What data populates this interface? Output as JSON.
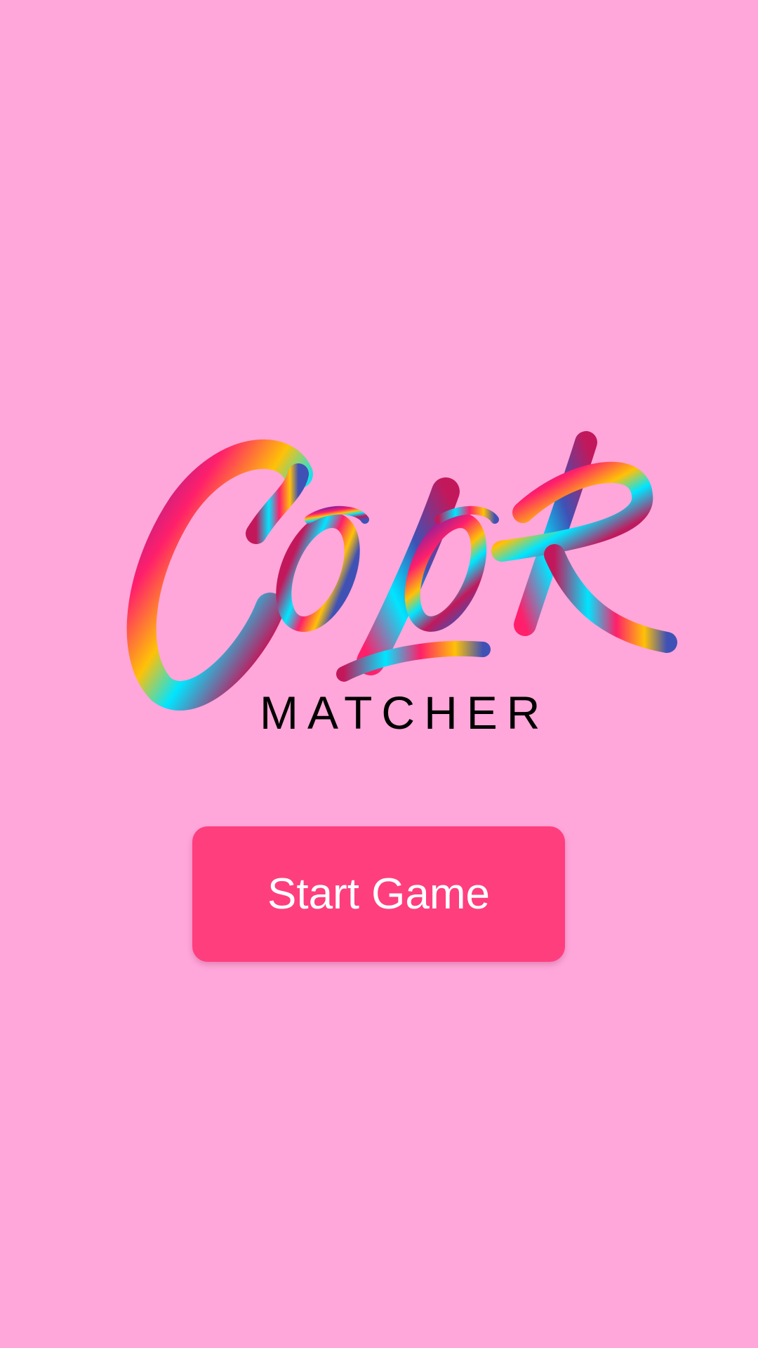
{
  "app": {
    "background_color": "#FFA6DA"
  },
  "logo": {
    "word": "COLOR",
    "subtitle": "MATCHER",
    "stroke_colors": [
      "#C2185B",
      "#FF1F6B",
      "#FFC107",
      "#00E5FF",
      "#3F51B5",
      "#7B1FA2"
    ]
  },
  "start_button": {
    "label": "Start Game",
    "color": "#FF3E7E"
  }
}
